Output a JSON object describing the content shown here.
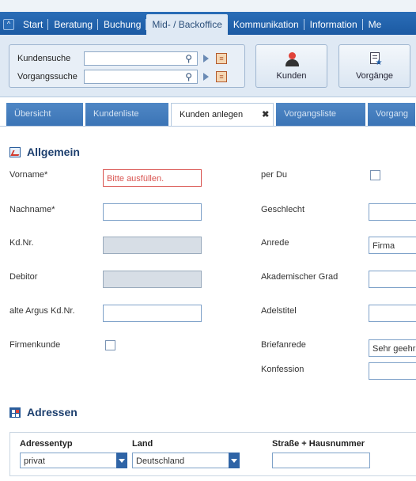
{
  "nav": {
    "tabs": [
      {
        "label": "Start"
      },
      {
        "label": "Beratung"
      },
      {
        "label": "Buchung"
      },
      {
        "label": "Mid- / Backoffice"
      },
      {
        "label": "Kommunikation"
      },
      {
        "label": "Information"
      },
      {
        "label": "Me"
      }
    ],
    "active_index": 3
  },
  "search": {
    "kundensuche_label": "Kundensuche",
    "vorgangssuche_label": "Vorgangssuche",
    "kundensuche_value": "",
    "vorgangssuche_value": ""
  },
  "toolbar": {
    "kunden_label": "Kunden",
    "vorgaenge_label": "Vorgänge"
  },
  "subtabs": [
    {
      "label": "Übersicht"
    },
    {
      "label": "Kundenliste"
    },
    {
      "label": "Kunden anlegen",
      "closable": true
    },
    {
      "label": "Vorgangsliste"
    },
    {
      "label": "Vorgang"
    }
  ],
  "allgemein": {
    "title": "Allgemein",
    "vorname_label": "Vorname*",
    "vorname_value": "Bitte ausfüllen.",
    "nachname_label": "Nachname*",
    "kdnr_label": "Kd.Nr.",
    "debitor_label": "Debitor",
    "alte_argus_label": "alte Argus Kd.Nr.",
    "firmenkunde_label": "Firmenkunde",
    "perdu_label": "per Du",
    "geschlecht_label": "Geschlecht",
    "anrede_label": "Anrede",
    "anrede_value": "Firma",
    "akad_grad_label": "Akademischer Grad",
    "adelstitel_label": "Adelstitel",
    "briefanrede_label": "Briefanrede",
    "briefanrede_value": "Sehr geehr",
    "konfession_label": "Konfession"
  },
  "adressen": {
    "title": "Adressen",
    "col_typ": "Adressentyp",
    "col_land": "Land",
    "col_strasse": "Straße + Hausnummer",
    "typ_value": "privat",
    "land_value": "Deutschland",
    "strasse_value": ""
  }
}
